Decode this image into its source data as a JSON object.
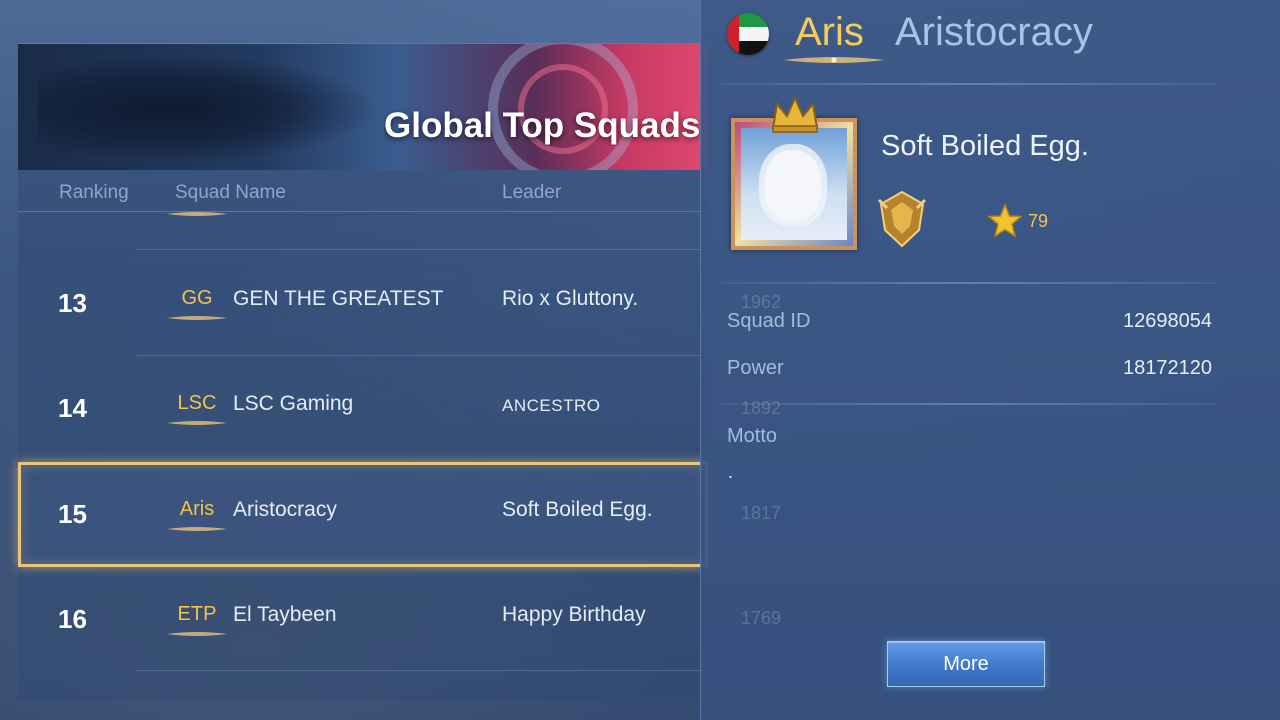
{
  "leaderboard": {
    "title": "Global Top Squads",
    "columns": {
      "ranking": "Ranking",
      "squad_name": "Squad Name",
      "leader": "Leader"
    },
    "rows": [
      {
        "rank": "13",
        "tag": "GG",
        "name": "GEN THE GREATEST",
        "leader": "Rio x Gluttony.",
        "power_partial": "1962"
      },
      {
        "rank": "14",
        "tag": "LSC",
        "name": "LSC Gaming",
        "leader": "ANCESTRO",
        "power_partial": "1892"
      },
      {
        "rank": "15",
        "tag": "Aris",
        "name": "Aristocracy",
        "leader": "Soft Boiled Egg.",
        "power_partial": "1817"
      },
      {
        "rank": "16",
        "tag": "ETP",
        "name": "El Taybeen",
        "leader": "Happy Birthday",
        "power_partial": "1769"
      }
    ],
    "selected_rank": "15"
  },
  "detail": {
    "tag": "Aris",
    "squad_name": "Aristocracy",
    "leader_name": "Soft Boiled Egg.",
    "stars": "79",
    "squad_id_label": "Squad ID",
    "squad_id": "12698054",
    "power_label": "Power",
    "power": "18172120",
    "motto_label": "Motto",
    "motto": ".",
    "more_label": "More",
    "colors": {
      "tag": "#f3cd5c",
      "name": "#a9c3e6",
      "accent": "#f1c44b"
    }
  },
  "icons": [
    "uae-flag-icon",
    "crown-icon",
    "rank-badge-icon",
    "star-icon"
  ]
}
